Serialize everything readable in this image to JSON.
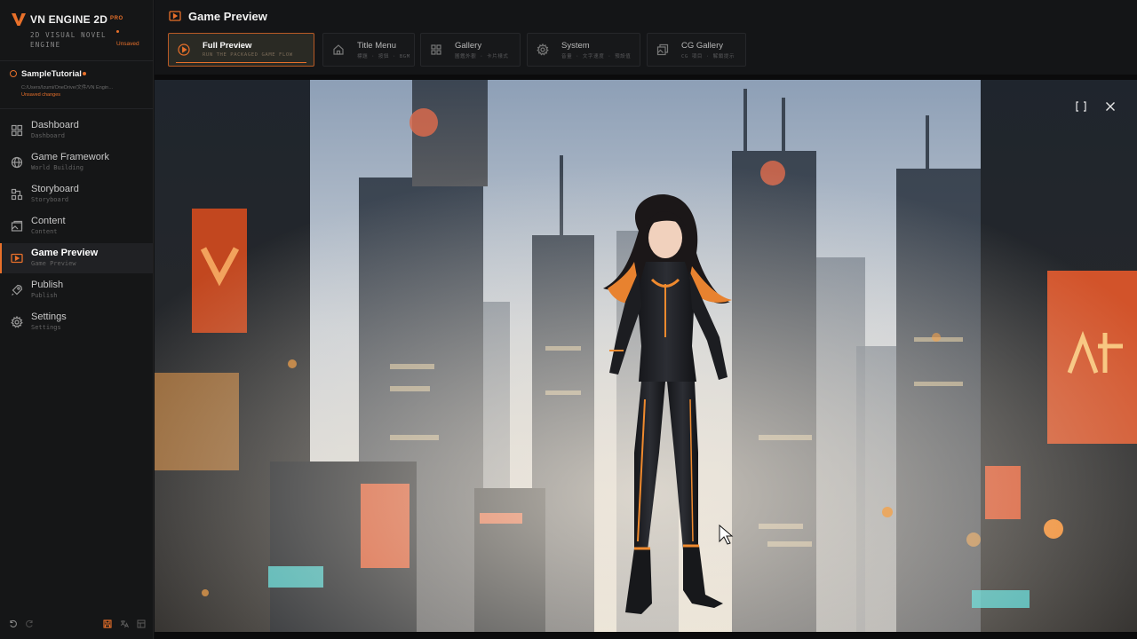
{
  "app": {
    "name": "VN ENGINE 2D",
    "badge": "PRO",
    "subtitle_line1": "2D VISUAL NOVEL",
    "subtitle_line2": "ENGINE",
    "save_state": "Unsaved"
  },
  "project": {
    "name": "SampleTutorial",
    "path": "C:/Users/Izumi/OneDrive/文件/VN Engin…",
    "status": "Unsaved changes"
  },
  "sidebar": {
    "items": [
      {
        "label": "Dashboard",
        "sub": "Dashboard",
        "icon": "grid-icon"
      },
      {
        "label": "Game Framework",
        "sub": "World Building",
        "icon": "globe-icon"
      },
      {
        "label": "Storyboard",
        "sub": "Storyboard",
        "icon": "storyboard-icon"
      },
      {
        "label": "Content",
        "sub": "Content",
        "icon": "content-icon"
      },
      {
        "label": "Game Preview",
        "sub": "Game Preview",
        "icon": "play-icon",
        "active": true
      },
      {
        "label": "Publish",
        "sub": "Publish",
        "icon": "rocket-icon"
      },
      {
        "label": "Settings",
        "sub": "Settings",
        "icon": "gear-icon"
      }
    ]
  },
  "header": {
    "title": "Game Preview",
    "tabs": [
      {
        "label": "Full Preview",
        "sub": "RUN THE PACKAGED GAME FLOW",
        "icon": "play-circle-icon",
        "active": true
      },
      {
        "label": "Title Menu",
        "sub": "標題 · 按鈕 · BGM",
        "icon": "home-icon"
      },
      {
        "label": "Gallery",
        "sub": "圖鑑外觀 · 卡片樣式",
        "icon": "grid-icon"
      },
      {
        "label": "System",
        "sub": "音量 · 文字速度 · 預設值",
        "icon": "gear-icon"
      },
      {
        "label": "CG Gallery",
        "sub": "CG 項目 · 解鎖提示",
        "icon": "image-stack-icon"
      }
    ]
  },
  "colors": {
    "accent": "#e8702a",
    "sidebar_bg": "#151617",
    "topbar_bg": "#141517"
  }
}
